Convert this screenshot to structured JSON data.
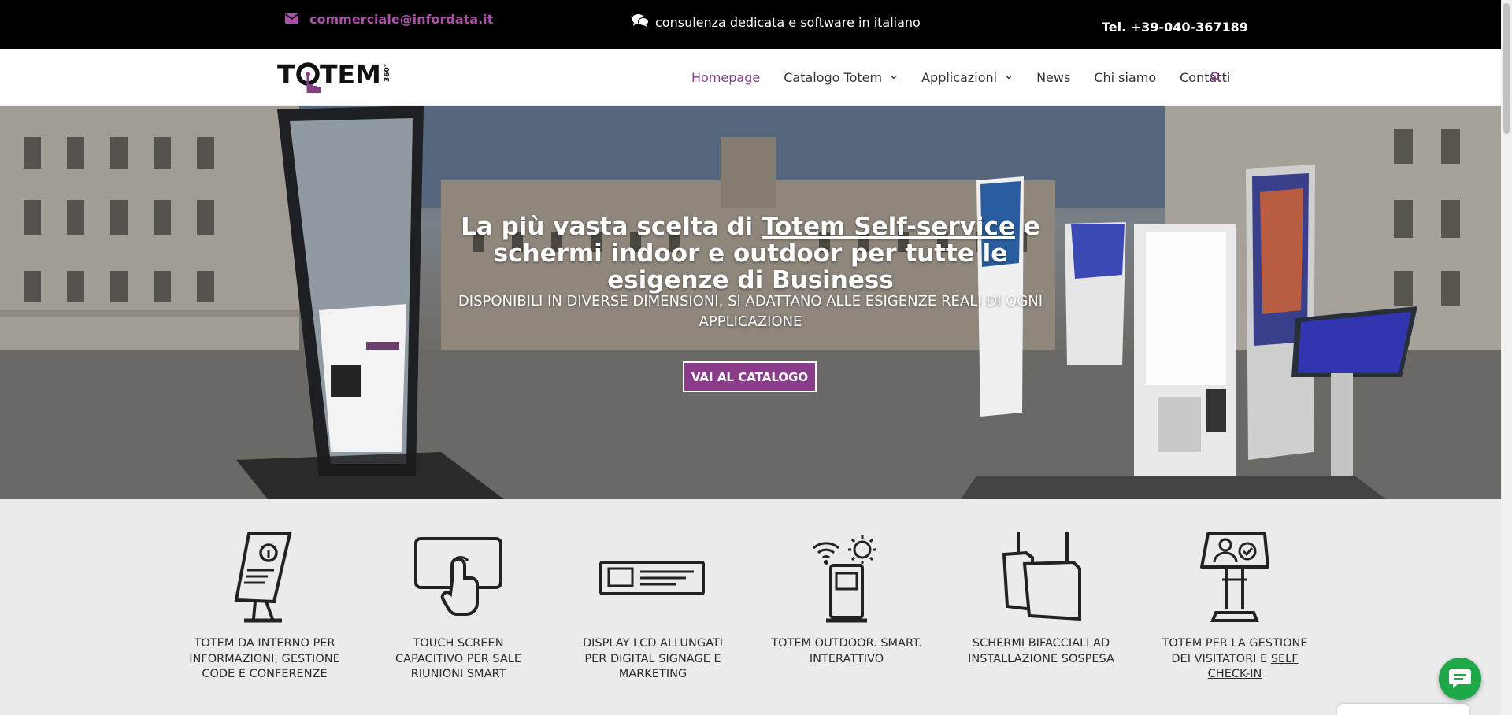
{
  "topbar": {
    "email": "commerciale@infordata.it",
    "consult": "consulenza dedicata e software in italiano",
    "phone": "Tel. +39-040-367189"
  },
  "brand": {
    "logo_text": "TOTEM",
    "logo_badge": "360°"
  },
  "nav": {
    "items": [
      {
        "label": "Homepage"
      },
      {
        "label": "Catalogo Totem"
      },
      {
        "label": "Applicazioni"
      },
      {
        "label": "News"
      },
      {
        "label": "Chi siamo"
      },
      {
        "label": "Contatti"
      }
    ]
  },
  "hero": {
    "title_pre": "La più vasta scelta di ",
    "title_link": "Totem Self-service",
    "title_post": " e schermi indoor e outdoor per tutte le esigenze di Business",
    "subtitle": "DISPONIBILI IN DIVERSE DIMENSIONI, SI ADATTANO ALLE ESIGENZE REALI DI OGNI APPLICAZIONE",
    "button": "VAI AL CATALOGO"
  },
  "features": [
    {
      "label": "TOTEM DA INTERNO PER INFORMAZIONI, GESTIONE CODE E CONFERENZE",
      "icon": "info-kiosk-icon"
    },
    {
      "label": "TOUCH SCREEN CAPACITIVO PER SALE RIUNIONI SMART",
      "icon": "touch-screen-icon"
    },
    {
      "label": "DISPLAY LCD ALLUNGATI PER DIGITAL SIGNAGE E MARKETING",
      "icon": "stretched-display-icon"
    },
    {
      "label": "TOTEM OUTDOOR. SMART. INTERATTIVO",
      "icon": "outdoor-kiosk-icon"
    },
    {
      "label": "SCHERMI BIFACCIALI AD INSTALLAZIONE SOSPESA",
      "icon": "hanging-screens-icon"
    },
    {
      "label_pre": "TOTEM PER LA GESTIONE DEI VISITATORI E ",
      "label_link": "SELF CHECK-IN",
      "icon": "visitor-kiosk-icon"
    }
  ],
  "colors": {
    "accent": "#8a3c8a",
    "topbar_bg": "#000000",
    "chat": "#1fa84a"
  }
}
